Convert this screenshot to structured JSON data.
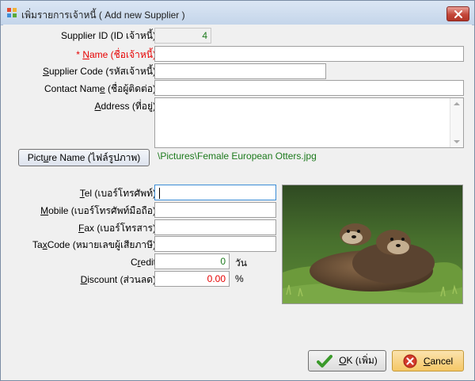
{
  "window": {
    "title": "เพิ่มรายการเจ้าหนี้ ( Add new Supplier )",
    "accent": "#c4473a"
  },
  "form": {
    "supplier_id": {
      "label": "Supplier ID (ID เจ้าหนี้)",
      "value": "4"
    },
    "name": {
      "required_mark": "* ",
      "label_key": "N",
      "label_rest": "ame (ชื่อเจ้าหนี้)",
      "value": ""
    },
    "supplier_code": {
      "label_key": "S",
      "label_rest": "upplier Code (รหัสเจ้าหนี้)",
      "value": ""
    },
    "contact_name": {
      "label_pre": "Contact Nam",
      "label_key": "e",
      "label_rest": " (ชื่อผู้ติดต่อ)",
      "value": ""
    },
    "address": {
      "label_key": "A",
      "label_rest": "ddress (ที่อยู่)",
      "value": ""
    },
    "picture": {
      "button_pre": "Pict",
      "button_key": "u",
      "button_rest": "re Name (ไฟล์รูปภาพ)",
      "path": "\\Pictures\\Female European Otters.jpg",
      "image_icon": "otters-photo"
    },
    "tel": {
      "label_key": "T",
      "label_rest": "el (เบอร์โทรศัพท์)",
      "value": ""
    },
    "mobile": {
      "label_key": "M",
      "label_rest": "obile (เบอร์โทรศัพท์มือถือ)",
      "value": ""
    },
    "fax": {
      "label_key": "F",
      "label_rest": "ax (เบอร์โทรสาร)",
      "value": ""
    },
    "taxcode": {
      "label_pre": "Ta",
      "label_key": "x",
      "label_rest": "Code (หมายเลขผู้เสียภาษี)",
      "value": ""
    },
    "credit": {
      "label_pre": "C",
      "label_key": "r",
      "label_rest": "edit",
      "value": "0",
      "unit": "วัน",
      "value_color": "#1d7a1d"
    },
    "discount": {
      "label_key": "D",
      "label_rest": "iscount (ส่วนลด)",
      "value": "0.00",
      "unit": "%",
      "value_color": "#e60000"
    }
  },
  "buttons": {
    "ok": {
      "key": "O",
      "rest": "K (เพิ่ม)",
      "icon": "checkmark-icon",
      "icon_color": "#3a9a2a"
    },
    "cancel": {
      "key": "C",
      "rest": "ancel",
      "icon": "cancel-icon",
      "icon_color": "#d23a2a"
    }
  }
}
